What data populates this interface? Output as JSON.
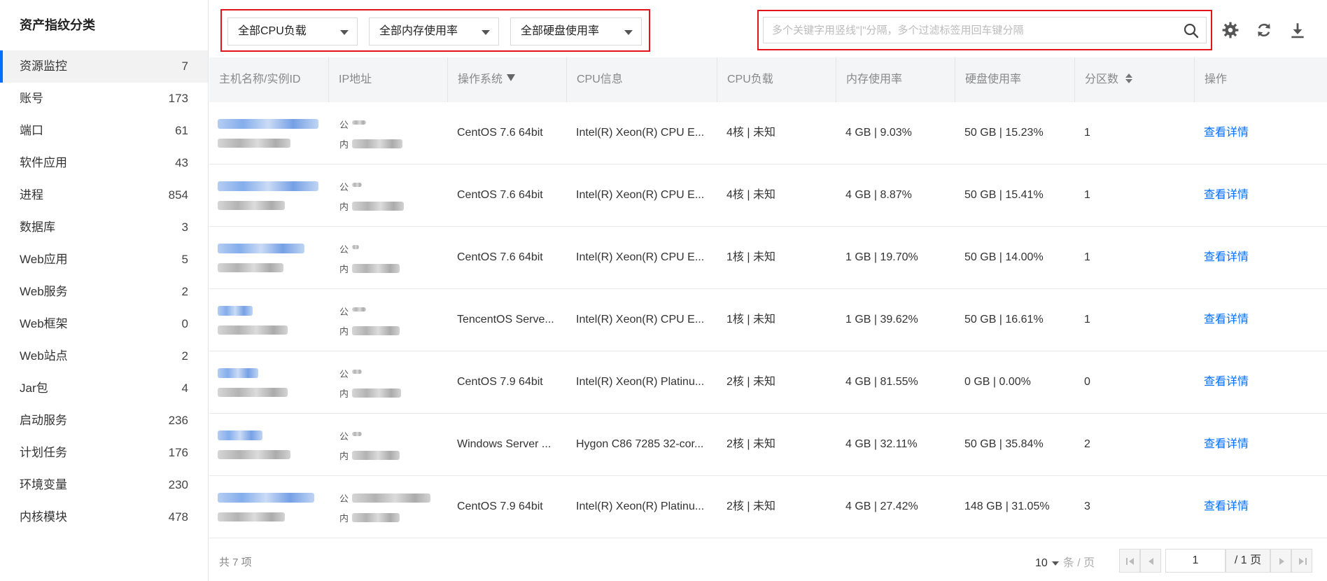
{
  "sidebar": {
    "title": "资产指纹分类",
    "items": [
      {
        "label": "资源监控",
        "count": "7"
      },
      {
        "label": "账号",
        "count": "173"
      },
      {
        "label": "端口",
        "count": "61"
      },
      {
        "label": "软件应用",
        "count": "43"
      },
      {
        "label": "进程",
        "count": "854"
      },
      {
        "label": "数据库",
        "count": "3"
      },
      {
        "label": "Web应用",
        "count": "5"
      },
      {
        "label": "Web服务",
        "count": "2"
      },
      {
        "label": "Web框架",
        "count": "0"
      },
      {
        "label": "Web站点",
        "count": "2"
      },
      {
        "label": "Jar包",
        "count": "4"
      },
      {
        "label": "启动服务",
        "count": "236"
      },
      {
        "label": "计划任务",
        "count": "176"
      },
      {
        "label": "环境变量",
        "count": "230"
      },
      {
        "label": "内核模块",
        "count": "478"
      }
    ]
  },
  "filters": {
    "cpu": "全部CPU负载",
    "memory": "全部内存使用率",
    "disk": "全部硬盘使用率"
  },
  "search": {
    "placeholder": "多个关键字用竖线\"|\"分隔，多个过滤标签用回车键分隔"
  },
  "toolbar_icons": [
    "gear-icon",
    "refresh-icon",
    "download-icon"
  ],
  "table": {
    "headers": [
      "主机名称/实例ID",
      "IP地址",
      "操作系统",
      "CPU信息",
      "CPU负载",
      "内存使用率",
      "硬盘使用率",
      "分区数",
      "操作"
    ],
    "ip_public_label": "公",
    "ip_private_label": "内",
    "rows": [
      {
        "os": "CentOS 7.6 64bit",
        "cpu_info": "Intel(R) Xeon(R) CPU E...",
        "cpu_load": "4核 | 未知",
        "memory": "4 GB | 9.03%",
        "disk": "50 GB | 15.23%",
        "partitions": "1",
        "action": "查看详情"
      },
      {
        "os": "CentOS 7.6 64bit",
        "cpu_info": "Intel(R) Xeon(R) CPU E...",
        "cpu_load": "4核 | 未知",
        "memory": "4 GB | 8.87%",
        "disk": "50 GB | 15.41%",
        "partitions": "1",
        "action": "查看详情"
      },
      {
        "os": "CentOS 7.6 64bit",
        "cpu_info": "Intel(R) Xeon(R) CPU E...",
        "cpu_load": "1核 | 未知",
        "memory": "1 GB | 19.70%",
        "disk": "50 GB | 14.00%",
        "partitions": "1",
        "action": "查看详情"
      },
      {
        "os": "TencentOS Serve...",
        "cpu_info": "Intel(R) Xeon(R) CPU E...",
        "cpu_load": "1核 | 未知",
        "memory": "1 GB | 39.62%",
        "disk": "50 GB | 16.61%",
        "partitions": "1",
        "action": "查看详情"
      },
      {
        "os": "CentOS 7.9 64bit",
        "cpu_info": "Intel(R) Xeon(R) Platinu...",
        "cpu_load": "2核 | 未知",
        "memory": "4 GB | 81.55%",
        "disk": "0 GB | 0.00%",
        "partitions": "0",
        "action": "查看详情"
      },
      {
        "os": "Windows Server ...",
        "cpu_info": "Hygon C86 7285 32-cor...",
        "cpu_load": "2核 | 未知",
        "memory": "4 GB | 32.11%",
        "disk": "50 GB | 35.84%",
        "partitions": "2",
        "action": "查看详情"
      },
      {
        "os": "CentOS 7.9 64bit",
        "cpu_info": "Intel(R) Xeon(R) Platinu...",
        "cpu_load": "2核 | 未知",
        "memory": "4 GB | 27.42%",
        "disk": "148 GB | 31.05%",
        "partitions": "3",
        "action": "查看详情"
      }
    ]
  },
  "footer": {
    "total": "共 7 项",
    "page_size": "10",
    "page_size_unit": "条 / 页",
    "current_page": "1",
    "total_pages": "/ 1 页"
  },
  "colors": {
    "accent": "#006eff",
    "highlight_border": "#e0141a"
  }
}
